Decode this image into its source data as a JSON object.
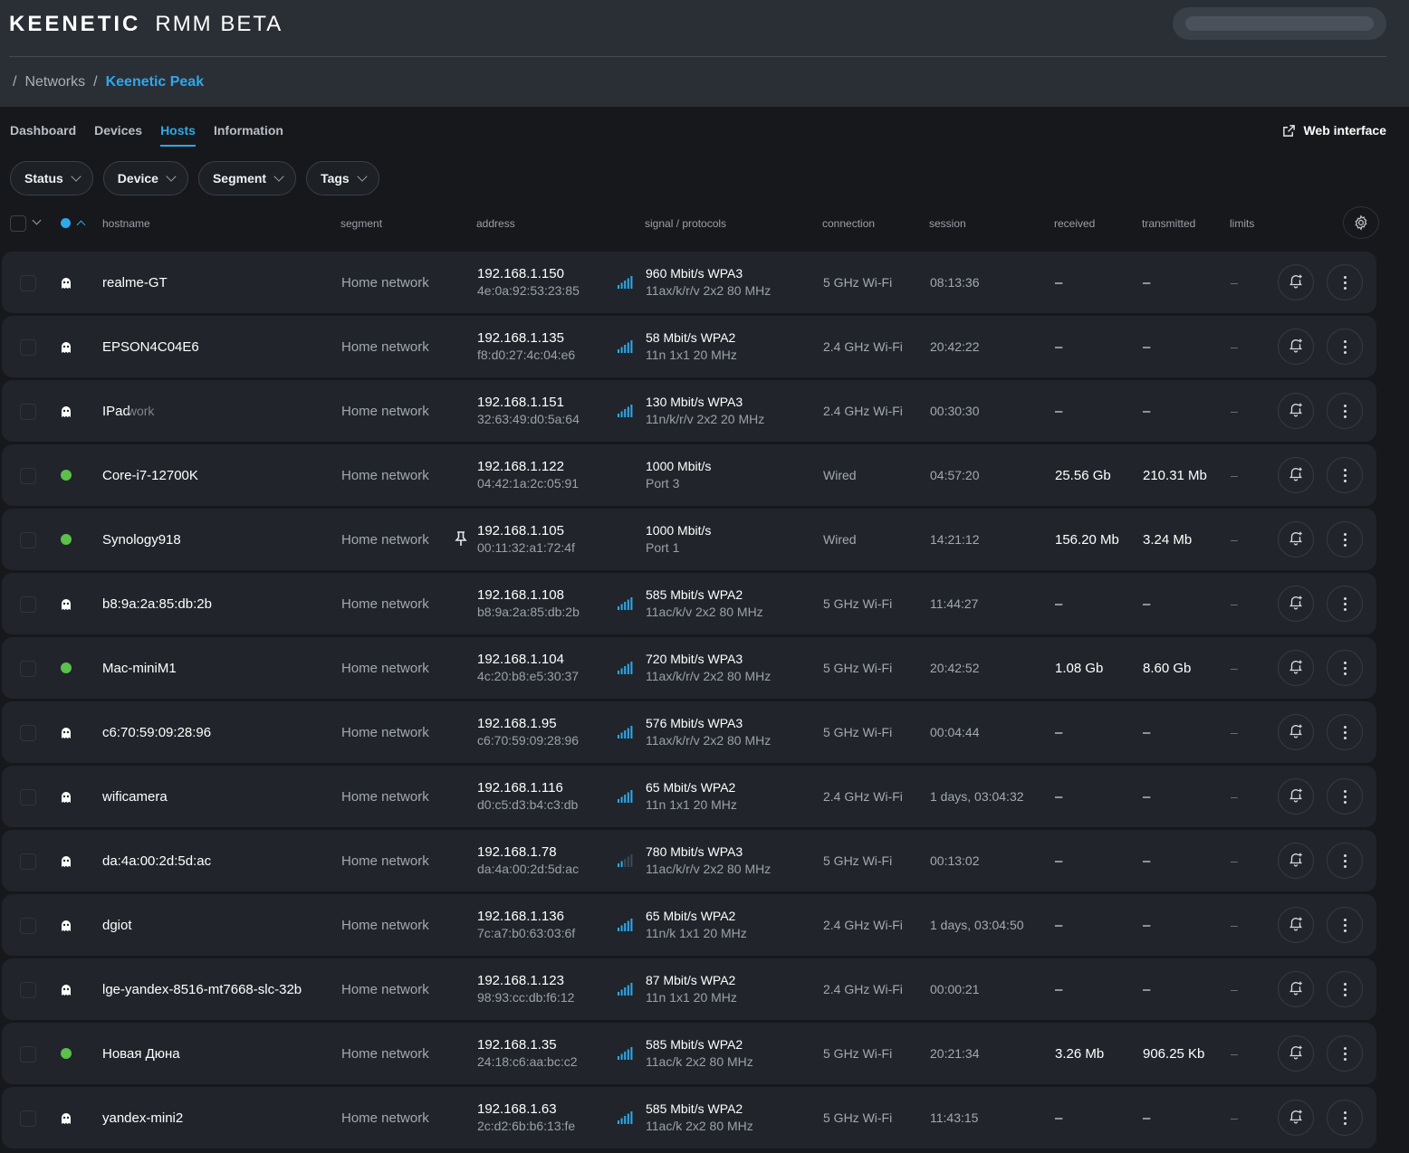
{
  "app": {
    "brand_main": "KEENETIC",
    "brand_sub": "RMM BETA"
  },
  "breadcrumb": {
    "sep": "/",
    "parent": "Networks",
    "current": "Keenetic Peak"
  },
  "tabs": [
    "Dashboard",
    "Devices",
    "Hosts",
    "Information"
  ],
  "active_tab": "Hosts",
  "web_interface_label": "Web interface",
  "filters": [
    "Status",
    "Device",
    "Segment",
    "Tags"
  ],
  "columns": {
    "hostname": "hostname",
    "segment": "segment",
    "address": "address",
    "signal": "signal / protocols",
    "connection": "connection",
    "session": "session",
    "received": "received",
    "transmitted": "transmitted",
    "limits": "limits"
  },
  "colors": {
    "accent": "#2fa8ea",
    "online": "#5cc04a",
    "bg": "#16181c",
    "row": "#21252b"
  },
  "icons": {
    "status_offline": "ghost-icon",
    "status_online": "online-dot",
    "signal": "signal-bars-icon",
    "action1": "bell-add-icon",
    "action2": "more-vertical-icon",
    "settings": "gear-icon",
    "external": "external-link-icon",
    "pin": "pin-icon"
  },
  "hosts": [
    {
      "hostname": "realme-GT",
      "status": "offline",
      "segment": "Home network",
      "ip": "192.168.1.150",
      "mac": "4e:0a:92:53:23:85",
      "signal": 5,
      "speed": "960 Mbit/s WPA3",
      "proto": "11ax/k/r/v 2x2 80 MHz",
      "connection": "5 GHz Wi-Fi",
      "session": "08:13:36",
      "received": "–",
      "transmitted": "–",
      "limits": "–"
    },
    {
      "hostname": "EPSON4C04E6",
      "status": "offline",
      "segment": "Home network",
      "ip": "192.168.1.135",
      "mac": "f8:d0:27:4c:04:e6",
      "signal": 5,
      "speed": "58 Mbit/s WPA2",
      "proto": "11n 1x1 20 MHz",
      "connection": "2.4 GHz Wi-Fi",
      "session": "20:42:22",
      "received": "–",
      "transmitted": "–",
      "limits": "–"
    },
    {
      "hostname": "IPad",
      "hostname_ghost": "work",
      "status": "offline",
      "segment": "Home network",
      "ip": "192.168.1.151",
      "mac": "32:63:49:d0:5a:64",
      "signal": 5,
      "speed": "130 Mbit/s WPA3",
      "proto": "11n/k/r/v 2x2 20 MHz",
      "connection": "2.4 GHz Wi-Fi",
      "session": "00:30:30",
      "received": "–",
      "transmitted": "–",
      "limits": "–"
    },
    {
      "hostname": "Core-i7-12700K",
      "status": "online",
      "segment": "Home network",
      "ip": "192.168.1.122",
      "mac": "04:42:1a:2c:05:91",
      "signal": 0,
      "speed": "1000 Mbit/s",
      "proto": "Port 3",
      "connection": "Wired",
      "session": "04:57:20",
      "received": "25.56 Gb",
      "transmitted": "210.31 Mb",
      "limits": "–"
    },
    {
      "hostname": "Synology918",
      "status": "online",
      "pinned": true,
      "segment": "Home network",
      "ip": "192.168.1.105",
      "mac": "00:11:32:a1:72:4f",
      "signal": 0,
      "speed": "1000 Mbit/s",
      "proto": "Port 1",
      "connection": "Wired",
      "session": "14:21:12",
      "received": "156.20 Mb",
      "transmitted": "3.24 Mb",
      "limits": "–"
    },
    {
      "hostname": "b8:9a:2a:85:db:2b",
      "status": "offline",
      "segment": "Home network",
      "ip": "192.168.1.108",
      "mac": "b8:9a:2a:85:db:2b",
      "signal": 5,
      "speed": "585 Mbit/s WPA2",
      "proto": "11ac/k/v 2x2 80 MHz",
      "connection": "5 GHz Wi-Fi",
      "session": "11:44:27",
      "received": "–",
      "transmitted": "–",
      "limits": "–"
    },
    {
      "hostname": "Mac-miniM1",
      "status": "online",
      "segment": "Home network",
      "ip": "192.168.1.104",
      "mac": "4c:20:b8:e5:30:37",
      "signal": 5,
      "speed": "720 Mbit/s WPA3",
      "proto": "11ax/k/r/v 2x2 80 MHz",
      "connection": "5 GHz Wi-Fi",
      "session": "20:42:52",
      "received": "1.08 Gb",
      "transmitted": "8.60 Gb",
      "limits": "–"
    },
    {
      "hostname": "c6:70:59:09:28:96",
      "status": "offline",
      "segment": "Home network",
      "ip": "192.168.1.95",
      "mac": "c6:70:59:09:28:96",
      "signal": 5,
      "speed": "576 Mbit/s WPA3",
      "proto": "11ax/k/r/v 2x2 80 MHz",
      "connection": "5 GHz Wi-Fi",
      "session": "00:04:44",
      "received": "–",
      "transmitted": "–",
      "limits": "–"
    },
    {
      "hostname": "wificamera",
      "status": "offline",
      "segment": "Home network",
      "ip": "192.168.1.116",
      "mac": "d0:c5:d3:b4:c3:db",
      "signal": 5,
      "speed": "65 Mbit/s WPA2",
      "proto": "11n 1x1 20 MHz",
      "connection": "2.4 GHz Wi-Fi",
      "session": "1 days, 03:04:32",
      "received": "–",
      "transmitted": "–",
      "limits": "–"
    },
    {
      "hostname": "da:4a:00:2d:5d:ac",
      "status": "offline",
      "segment": "Home network",
      "ip": "192.168.1.78",
      "mac": "da:4a:00:2d:5d:ac",
      "signal": 2,
      "speed": "780 Mbit/s WPA3",
      "proto": "11ac/k/r/v 2x2 80 MHz",
      "connection": "5 GHz Wi-Fi",
      "session": "00:13:02",
      "received": "–",
      "transmitted": "–",
      "limits": "–"
    },
    {
      "hostname": "dgiot",
      "status": "offline",
      "segment": "Home network",
      "ip": "192.168.1.136",
      "mac": "7c:a7:b0:63:03:6f",
      "signal": 5,
      "speed": "65 Mbit/s WPA2",
      "proto": "11n/k 1x1 20 MHz",
      "connection": "2.4 GHz Wi-Fi",
      "session": "1 days, 03:04:50",
      "received": "–",
      "transmitted": "–",
      "limits": "–"
    },
    {
      "hostname": "lge-yandex-8516-mt7668-slc-32b",
      "status": "offline",
      "segment": "Home network",
      "ip": "192.168.1.123",
      "mac": "98:93:cc:db:f6:12",
      "signal": 5,
      "speed": "87 Mbit/s WPA2",
      "proto": "11n 1x1 20 MHz",
      "connection": "2.4 GHz Wi-Fi",
      "session": "00:00:21",
      "received": "–",
      "transmitted": "–",
      "limits": "–"
    },
    {
      "hostname": "Новая Дюна",
      "status": "online",
      "segment": "Home network",
      "ip": "192.168.1.35",
      "mac": "24:18:c6:aa:bc:c2",
      "signal": 5,
      "speed": "585 Mbit/s WPA2",
      "proto": "11ac/k 2x2 80 MHz",
      "connection": "5 GHz Wi-Fi",
      "session": "20:21:34",
      "received": "3.26 Mb",
      "transmitted": "906.25 Kb",
      "limits": "–"
    },
    {
      "hostname": "yandex-mini2",
      "status": "offline",
      "segment": "Home network",
      "ip": "192.168.1.63",
      "mac": "2c:d2:6b:b6:13:fe",
      "signal": 5,
      "speed": "585 Mbit/s WPA2",
      "proto": "11ac/k 2x2 80 MHz",
      "connection": "5 GHz Wi-Fi",
      "session": "11:43:15",
      "received": "–",
      "transmitted": "–",
      "limits": "–"
    }
  ]
}
